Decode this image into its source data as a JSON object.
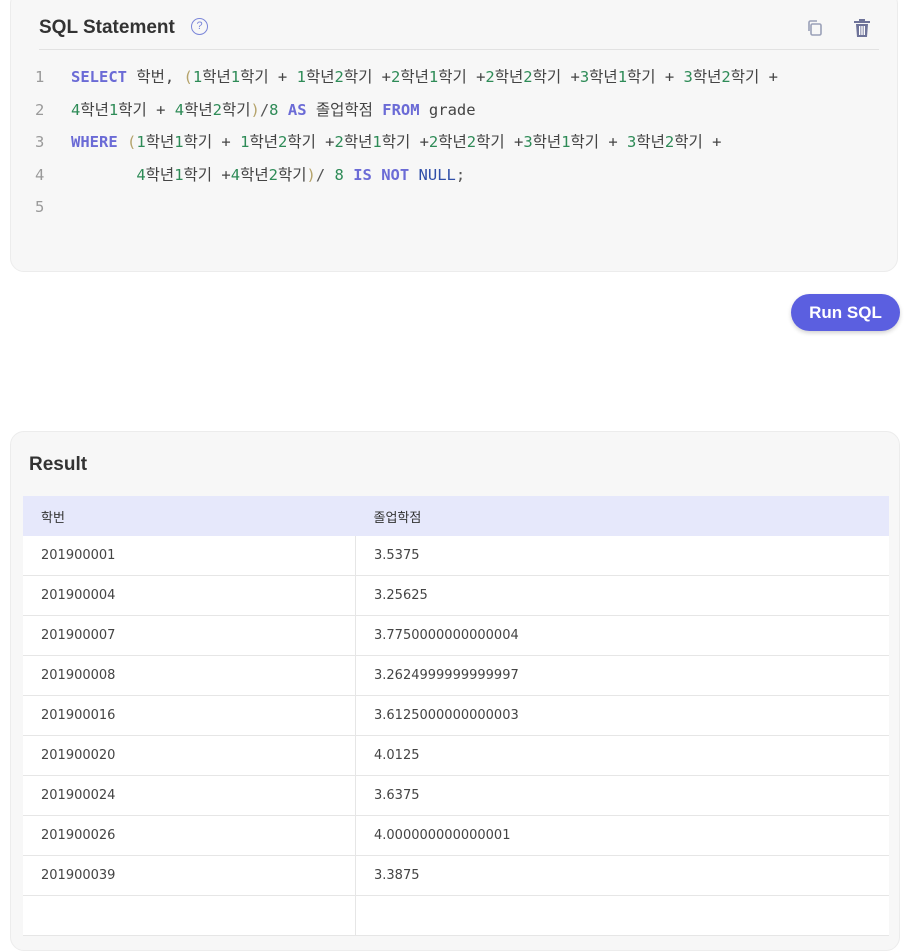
{
  "editor": {
    "title": "SQL Statement",
    "help_glyph": "?",
    "copy_icon": "copy-icon",
    "trash_icon": "trash-icon",
    "lines": [
      [
        {
          "t": "SELECT",
          "k": "kw"
        },
        {
          "t": " 학번, ",
          "k": "plain"
        },
        {
          "t": "(",
          "k": "par"
        },
        {
          "t": "1",
          "k": "num"
        },
        {
          "t": "학년",
          "k": "plain"
        },
        {
          "t": "1",
          "k": "num"
        },
        {
          "t": "학기 + ",
          "k": "plain"
        },
        {
          "t": "1",
          "k": "num"
        },
        {
          "t": "학년",
          "k": "plain"
        },
        {
          "t": "2",
          "k": "num"
        },
        {
          "t": "학기 +",
          "k": "plain"
        },
        {
          "t": "2",
          "k": "num"
        },
        {
          "t": "학년",
          "k": "plain"
        },
        {
          "t": "1",
          "k": "num"
        },
        {
          "t": "학기 +",
          "k": "plain"
        },
        {
          "t": "2",
          "k": "num"
        },
        {
          "t": "학년",
          "k": "plain"
        },
        {
          "t": "2",
          "k": "num"
        },
        {
          "t": "학기 +",
          "k": "plain"
        },
        {
          "t": "3",
          "k": "num"
        },
        {
          "t": "학년",
          "k": "plain"
        },
        {
          "t": "1",
          "k": "num"
        },
        {
          "t": "학기 + ",
          "k": "plain"
        },
        {
          "t": "3",
          "k": "num"
        },
        {
          "t": "학년",
          "k": "plain"
        },
        {
          "t": "2",
          "k": "num"
        },
        {
          "t": "학기 +",
          "k": "plain"
        }
      ],
      [
        {
          "t": "4",
          "k": "num"
        },
        {
          "t": "학년",
          "k": "plain"
        },
        {
          "t": "1",
          "k": "num"
        },
        {
          "t": "학기 + ",
          "k": "plain"
        },
        {
          "t": "4",
          "k": "num"
        },
        {
          "t": "학년",
          "k": "plain"
        },
        {
          "t": "2",
          "k": "num"
        },
        {
          "t": "학기",
          "k": "plain"
        },
        {
          "t": ")",
          "k": "par"
        },
        {
          "t": "/",
          "k": "op"
        },
        {
          "t": "8",
          "k": "num"
        },
        {
          "t": " ",
          "k": "plain"
        },
        {
          "t": "AS",
          "k": "kw"
        },
        {
          "t": " 졸업학점 ",
          "k": "plain"
        },
        {
          "t": "FROM",
          "k": "kw"
        },
        {
          "t": " grade",
          "k": "plain"
        }
      ],
      [
        {
          "t": "WHERE",
          "k": "kw"
        },
        {
          "t": " ",
          "k": "plain"
        },
        {
          "t": "(",
          "k": "par"
        },
        {
          "t": "1",
          "k": "num"
        },
        {
          "t": "학년",
          "k": "plain"
        },
        {
          "t": "1",
          "k": "num"
        },
        {
          "t": "학기 + ",
          "k": "plain"
        },
        {
          "t": "1",
          "k": "num"
        },
        {
          "t": "학년",
          "k": "plain"
        },
        {
          "t": "2",
          "k": "num"
        },
        {
          "t": "학기 +",
          "k": "plain"
        },
        {
          "t": "2",
          "k": "num"
        },
        {
          "t": "학년",
          "k": "plain"
        },
        {
          "t": "1",
          "k": "num"
        },
        {
          "t": "학기 +",
          "k": "plain"
        },
        {
          "t": "2",
          "k": "num"
        },
        {
          "t": "학년",
          "k": "plain"
        },
        {
          "t": "2",
          "k": "num"
        },
        {
          "t": "학기 +",
          "k": "plain"
        },
        {
          "t": "3",
          "k": "num"
        },
        {
          "t": "학년",
          "k": "plain"
        },
        {
          "t": "1",
          "k": "num"
        },
        {
          "t": "학기 + ",
          "k": "plain"
        },
        {
          "t": "3",
          "k": "num"
        },
        {
          "t": "학년",
          "k": "plain"
        },
        {
          "t": "2",
          "k": "num"
        },
        {
          "t": "학기 +",
          "k": "plain"
        }
      ],
      [
        {
          "t": "       ",
          "k": "plain"
        },
        {
          "t": "4",
          "k": "num"
        },
        {
          "t": "학년",
          "k": "plain"
        },
        {
          "t": "1",
          "k": "num"
        },
        {
          "t": "학기 +",
          "k": "plain"
        },
        {
          "t": "4",
          "k": "num"
        },
        {
          "t": "학년",
          "k": "plain"
        },
        {
          "t": "2",
          "k": "num"
        },
        {
          "t": "학기",
          "k": "plain"
        },
        {
          "t": ")",
          "k": "par"
        },
        {
          "t": "/ ",
          "k": "op"
        },
        {
          "t": "8",
          "k": "num"
        },
        {
          "t": " ",
          "k": "plain"
        },
        {
          "t": "IS",
          "k": "kw"
        },
        {
          "t": " ",
          "k": "plain"
        },
        {
          "t": "NOT",
          "k": "kw"
        },
        {
          "t": " ",
          "k": "plain"
        },
        {
          "t": "NULL",
          "k": "null"
        },
        {
          "t": ";",
          "k": "op"
        }
      ],
      []
    ],
    "line_numbers": [
      "1",
      "2",
      "3",
      "4",
      "5"
    ]
  },
  "run_button": {
    "label": "Run SQL"
  },
  "result": {
    "title": "Result",
    "columns": [
      "학번",
      "졸업학점"
    ],
    "rows": [
      [
        "201900001",
        "3.5375"
      ],
      [
        "201900004",
        "3.25625"
      ],
      [
        "201900007",
        "3.7750000000000004"
      ],
      [
        "201900008",
        "3.2624999999999997"
      ],
      [
        "201900016",
        "3.6125000000000003"
      ],
      [
        "201900020",
        "4.0125"
      ],
      [
        "201900024",
        "3.6375"
      ],
      [
        "201900026",
        "4.000000000000001"
      ],
      [
        "201900039",
        "3.3875"
      ],
      [
        "",
        ""
      ]
    ]
  }
}
